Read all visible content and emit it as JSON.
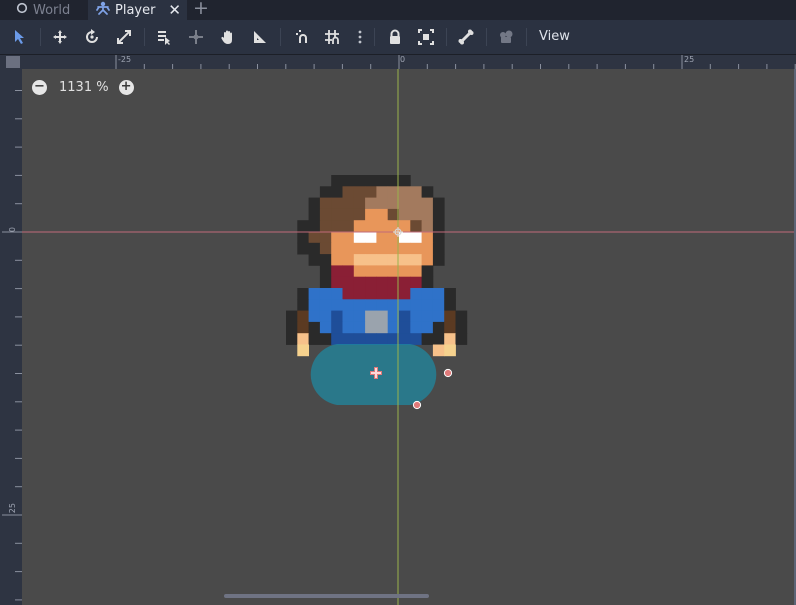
{
  "tabs": [
    {
      "label": "World",
      "icon": "circle-node-icon",
      "active": false
    },
    {
      "label": "Player",
      "icon": "kinematic-body-icon",
      "active": true
    }
  ],
  "toolbar": {
    "tools": [
      "select-tool-icon",
      "move-tool-icon",
      "rotate-tool-icon",
      "scale-tool-icon",
      "list-select-icon",
      "pivot-icon",
      "pan-hand-icon",
      "ruler-icon",
      "smart-snap-icon",
      "grid-snap-icon",
      "more-dots-icon",
      "lock-icon",
      "group-icon",
      "bone-icon",
      "camera-icon"
    ],
    "view_label": "View"
  },
  "viewport": {
    "zoom_value": "1131 %",
    "ruler_top_labels": [
      "-25",
      "0",
      "25"
    ],
    "ruler_left_labels": [
      "0",
      "25"
    ]
  },
  "colors": {
    "canvas_bg": "#4a4a4a",
    "axis_x": "#c06a7a",
    "axis_y": "#9ab24c",
    "collision_shape": "#1f8aa3",
    "handle": "#e07a7a",
    "accent": "#6b9ae8"
  }
}
